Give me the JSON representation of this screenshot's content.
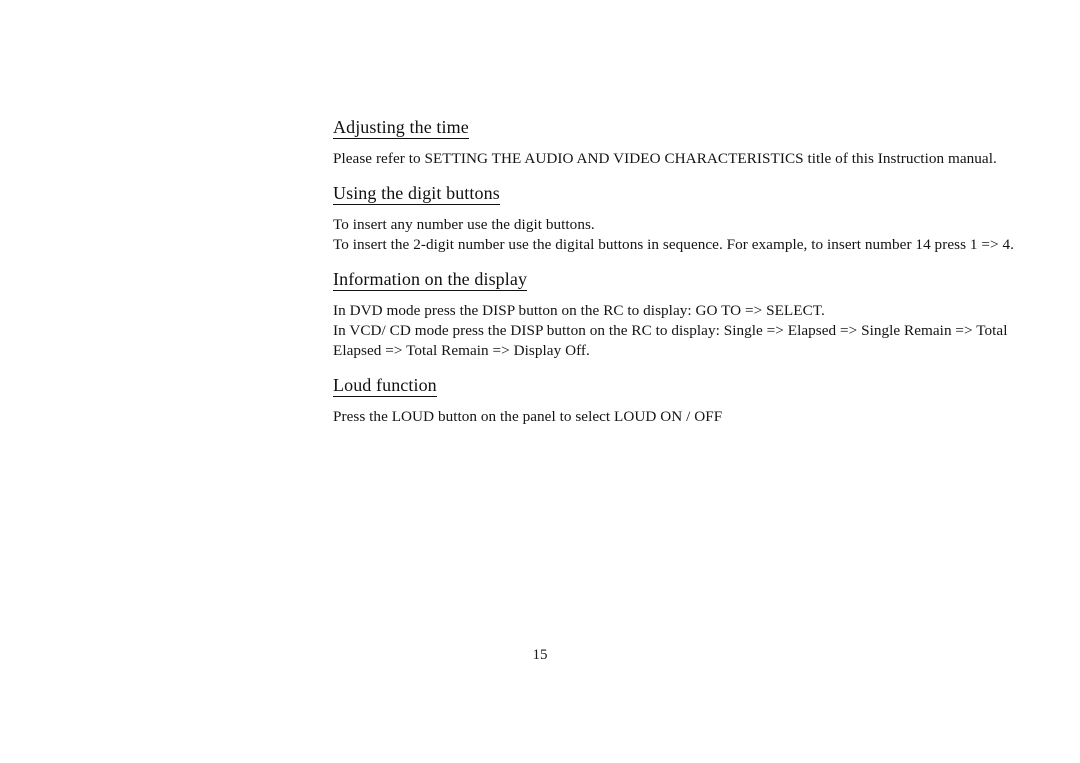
{
  "document": {
    "page_number": "15",
    "sections": [
      {
        "id": "adjusting-the-time",
        "heading": "Adjusting the time",
        "paragraphs": [
          "Please refer to SETTING THE AUDIO AND VIDEO CHARACTERISTICS title of this Instruction manual."
        ]
      },
      {
        "id": "using-the-digit-buttons",
        "heading": "Using the digit buttons",
        "paragraphs": [
          "To insert any number use the digit buttons.",
          "To insert the 2-digit number use the digital buttons in sequence. For example, to insert number 14 press 1 => 4."
        ]
      },
      {
        "id": "information-on-the-display",
        "heading": "Information on the display",
        "paragraphs": [
          "In DVD mode press the DISP button on the RC to display: GO TO => SELECT.",
          "In VCD/ CD mode press the DISP button on the RC to display: Single => Elapsed => Single Remain => Total Elapsed => Total Remain => Display Off."
        ]
      },
      {
        "id": "loud-function",
        "heading": "Loud function",
        "paragraphs": [
          "Press the LOUD button on the panel to select LOUD ON / OFF"
        ]
      }
    ]
  }
}
